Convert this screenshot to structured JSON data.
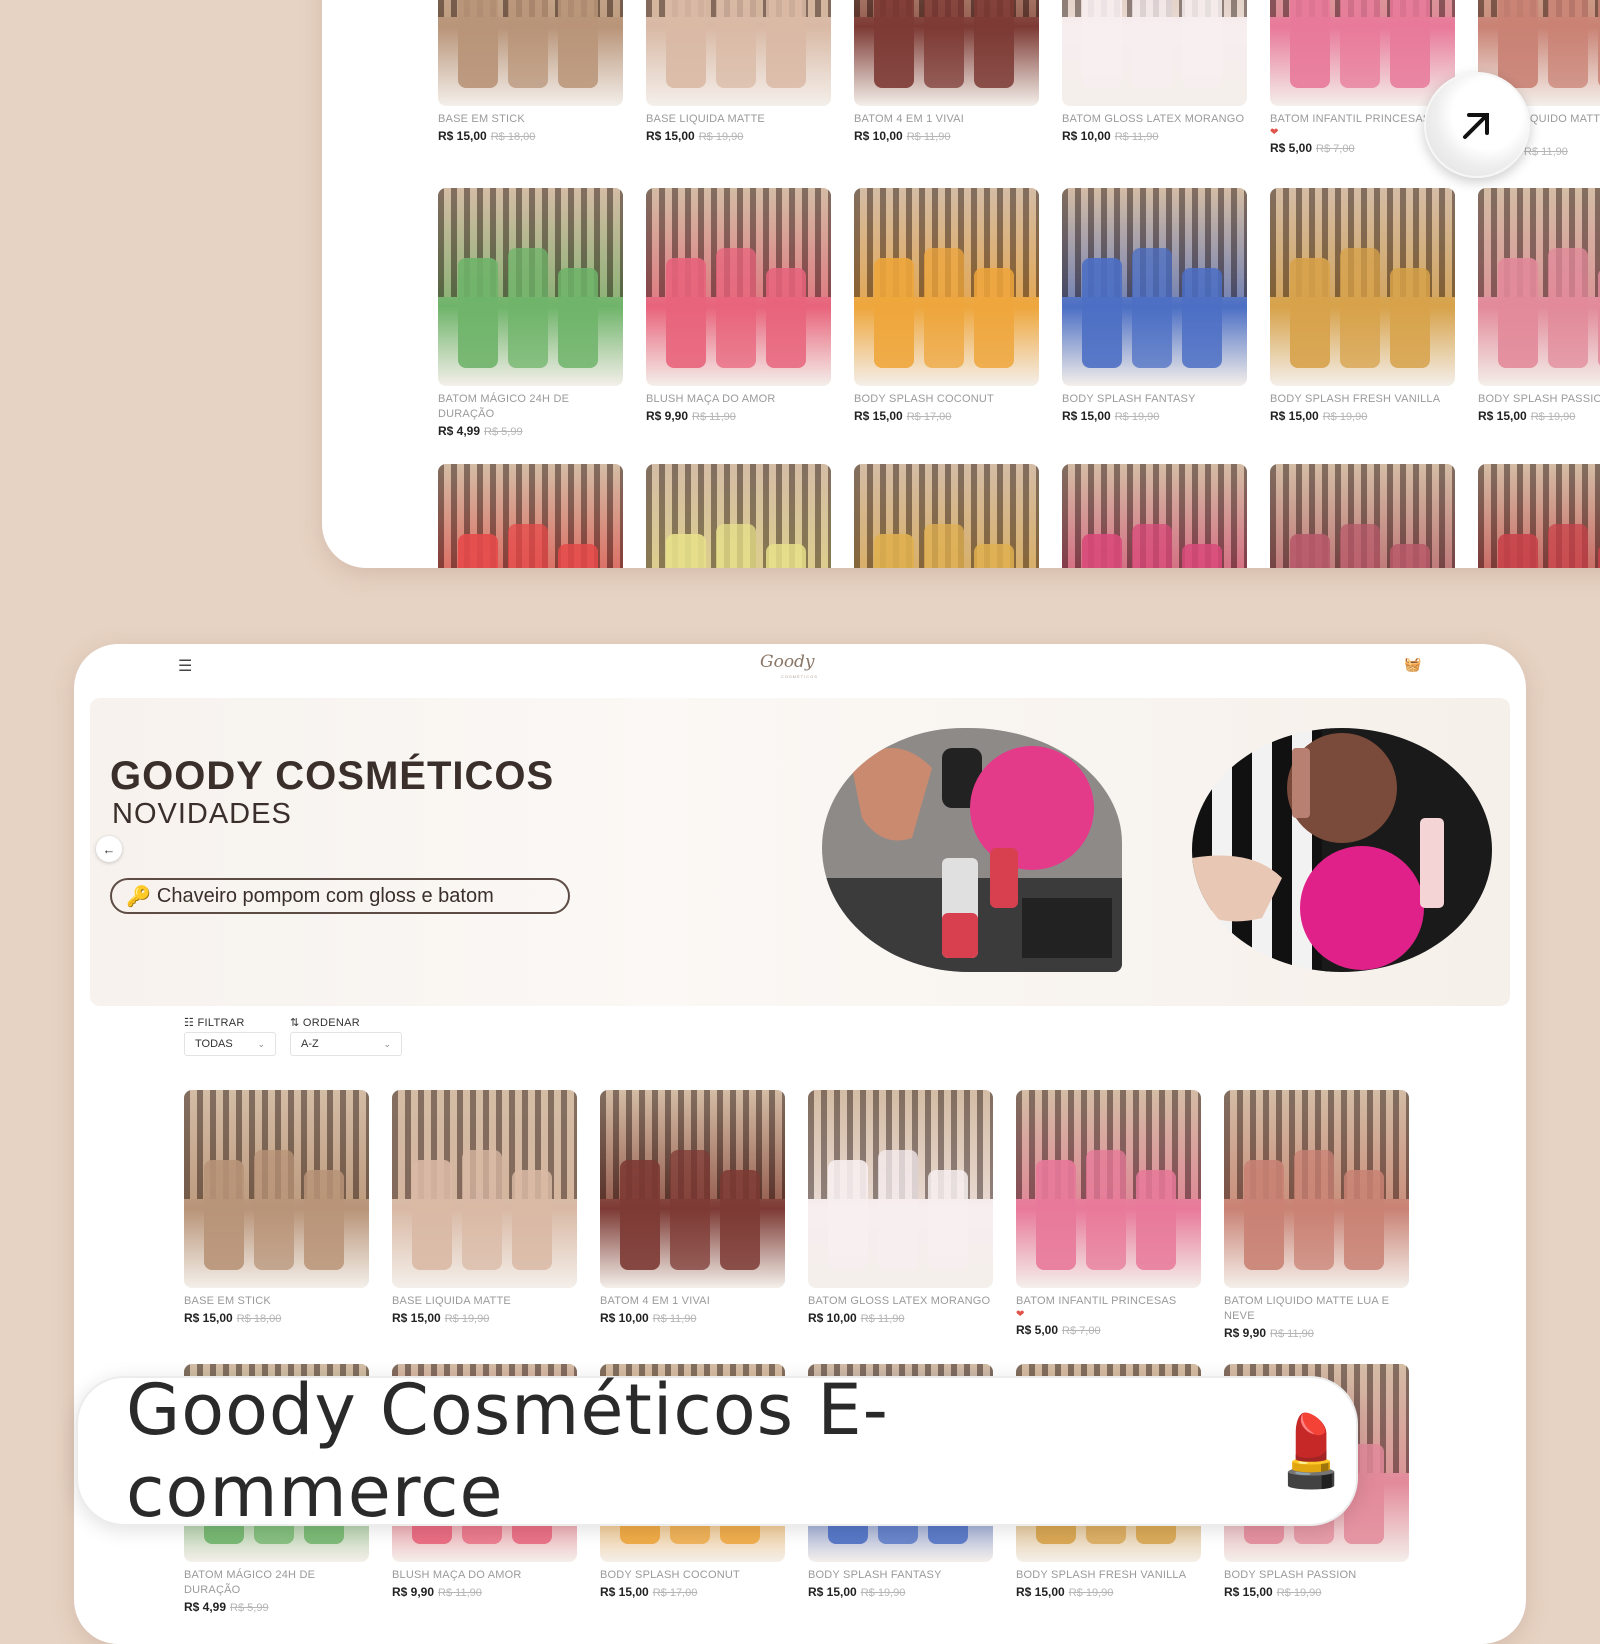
{
  "banner": {
    "title": "Goody Cosméticos E-commerce",
    "emoji": "💄"
  },
  "store": {
    "logo": "Goody",
    "logo_sub": "COSMÉTICOS",
    "menu_icon": "menu-icon",
    "cart_icon": "basket-icon"
  },
  "hero": {
    "title": "GOODY COSMÉTICOS",
    "subtitle": "NOVIDADES",
    "pill_icon": "🔑",
    "pill_text": "Chaveiro pompom com gloss e batom"
  },
  "filters": {
    "filter_label": "FILTRAR",
    "filter_value": "TODAS",
    "order_label": "ORDENAR",
    "order_value": "A-Z"
  },
  "colors": {
    "background": "#e7d3c3",
    "text": "#333333",
    "old_price": "#b5b5b5",
    "accent": "#e0524a"
  },
  "products_row1": [
    {
      "name": "BASE EM STICK",
      "price": "R$ 15,00",
      "old": "R$ 18,00",
      "heart": false,
      "bg": "#b89478"
    },
    {
      "name": "BASE LIQUIDA MATTE",
      "price": "R$ 15,00",
      "old": "R$ 19,90",
      "heart": false,
      "bg": "#d9b9a5"
    },
    {
      "name": "BATOM 4 EM 1 VIVAI",
      "price": "R$ 10,00",
      "old": "R$ 11,90",
      "heart": false,
      "bg": "#7d3a34"
    },
    {
      "name": "BATOM GLOSS LATEX MORANGO",
      "price": "R$ 10,00",
      "old": "R$ 11,90",
      "heart": false,
      "bg": "#f7eef0"
    },
    {
      "name": "BATOM INFANTIL PRINCESAS",
      "price": "R$ 5,00",
      "old": "R$ 7,00",
      "heart": true,
      "bg": "#e8799a"
    },
    {
      "name": "BATOM LIQUIDO MATTE LUA E NEVE",
      "price": "R$ 9,90",
      "old": "R$ 11,90",
      "heart": false,
      "bg": "#c98274"
    }
  ],
  "products_row2": [
    {
      "name": "BATOM MÁGICO 24H DE DURAÇÃO",
      "price": "R$ 4,99",
      "old": "R$ 5,99",
      "bg": "#6fb46a"
    },
    {
      "name": "BLUSH MAÇA DO AMOR",
      "price": "R$ 9,90",
      "old": "R$ 11,90",
      "bg": "#e8647c"
    },
    {
      "name": "BODY SPLASH COCONUT",
      "price": "R$ 15,00",
      "old": "R$ 17,00",
      "bg": "#eea63c"
    },
    {
      "name": "BODY SPLASH FANTASY",
      "price": "R$ 15,00",
      "old": "R$ 19,90",
      "bg": "#4c6fc4"
    },
    {
      "name": "BODY SPLASH FRESH VANILLA",
      "price": "R$ 15,00",
      "old": "R$ 19,90",
      "bg": "#d7a24a"
    },
    {
      "name": "BODY SPLASH PASSION",
      "price": "R$ 15,00",
      "old": "R$ 19,90",
      "bg": "#e28a9a"
    }
  ],
  "products_row3": [
    {
      "name": "",
      "bg": "#e54a4a"
    },
    {
      "name": "",
      "bg": "#e7e08a"
    },
    {
      "name": "",
      "bg": "#e0b050"
    },
    {
      "name": "",
      "bg": "#d94a7a"
    },
    {
      "name": "",
      "bg": "#b85a6a"
    },
    {
      "name": "",
      "bg": "#c8424a"
    }
  ]
}
